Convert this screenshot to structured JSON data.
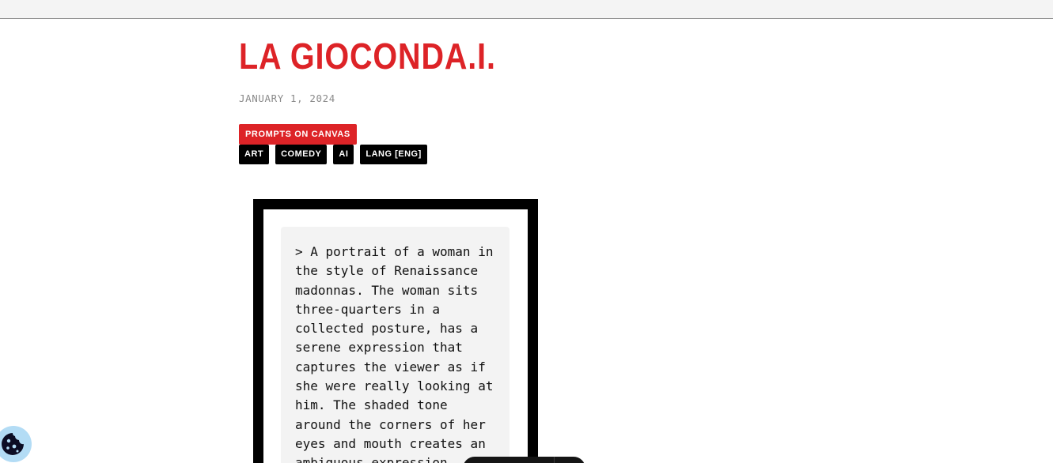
{
  "post": {
    "title": "LA GIOCONDA.I.",
    "date": "JANUARY 1, 2024",
    "category": "PROMPTS ON CANVAS",
    "tags": [
      "ART",
      "COMEDY",
      "AI",
      "LANG [ENG]"
    ],
    "prompt": "> A portrait of a woman in\nthe style of Renaissance\nmadonnas. The woman sits\nthree-quarters in a\ncollected posture, has a\nserene expression that\ncaptures the viewer as if\nshe were really looking at\nhim. The shaded tone\naround the corners of her\neyes and mouth creates an\nambiguous expression."
  },
  "colors": {
    "accent": "#dd2327",
    "tag_bg": "#000000",
    "cookie_badge": "#b3dcf5"
  },
  "icons": {
    "cookie": "cookie-icon"
  }
}
